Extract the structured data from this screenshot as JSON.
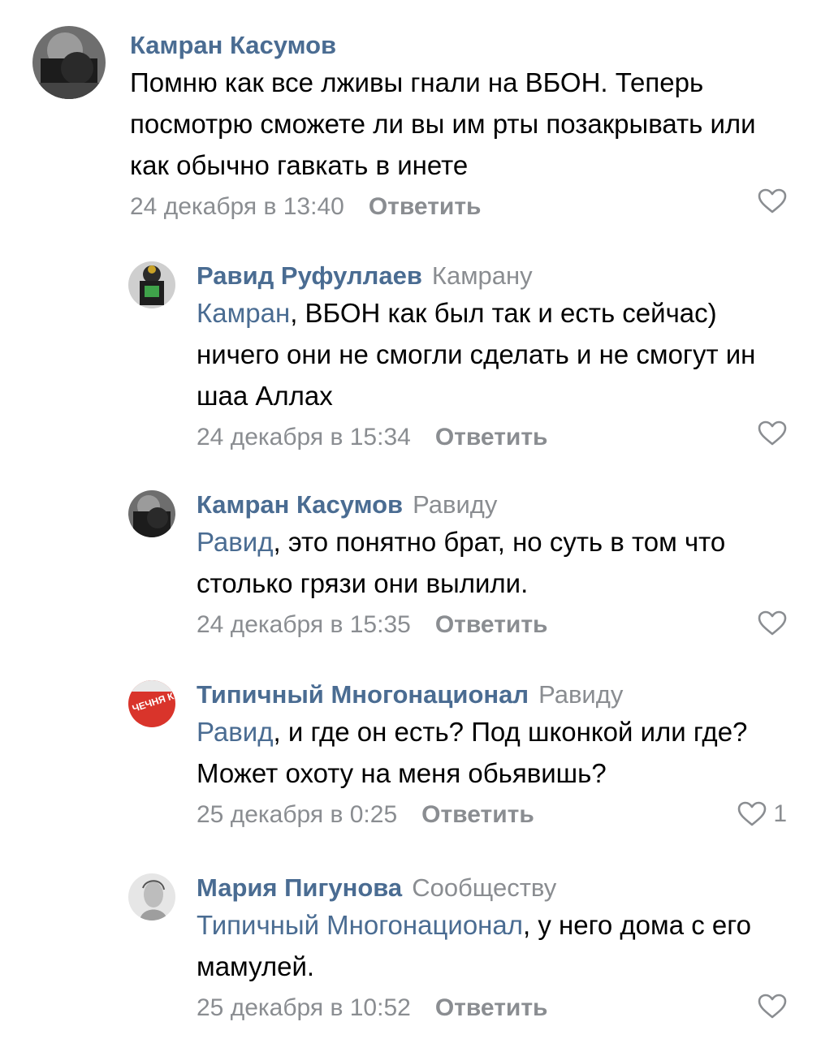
{
  "comments": [
    {
      "author": "Камран Касумов",
      "reply_to": "",
      "mention": "",
      "text": "Помню как все лживы гнали на ВБОН. Теперь посмотрю сможете ли вы им рты позакрывать или как обычно гавкать в инете",
      "date": "24 декабря в 13:40",
      "reply_label": "Ответить",
      "likes": "",
      "avatar_icon": "user-photo-dark"
    },
    {
      "author": "Равид Руфуллаев",
      "reply_to": "Камрану",
      "mention": "Камран",
      "text": ", ВБОН как был так и есть сейчас) ничего они не смогли сделать и не смогут ин шаа Аллах",
      "date": "24 декабря в 15:34",
      "reply_label": "Ответить",
      "likes": "",
      "avatar_icon": "user-photo-costume"
    },
    {
      "author": "Камран Касумов",
      "reply_to": "Равиду",
      "mention": "Равид",
      "text": ", это понятно брат, но суть в том что столько грязи они вылили.",
      "date": "24 декабря в 15:35",
      "reply_label": "Ответить",
      "likes": "",
      "avatar_icon": "user-photo-dark"
    },
    {
      "author": "Типичный Многонационал",
      "reply_to": "Равиду",
      "mention": "Равид",
      "text": ", и где он есть? Под шконкой или где? Может охоту на меня обьявишь?",
      "date": "25 декабря в 0:25",
      "reply_label": "Ответить",
      "likes": "1",
      "avatar_icon": "community-logo-red"
    },
    {
      "author": "Мария Пигунова",
      "reply_to": "Сообществу",
      "mention": "Типичный Многонационал",
      "text": ", у него дома с его мамулей.",
      "date": "25 декабря в 10:52",
      "reply_label": "Ответить",
      "likes": "",
      "avatar_icon": "user-photo-sketch"
    }
  ],
  "colors": {
    "author_link": "#4a6c92",
    "secondary_text": "#8a8d91",
    "background": "#ffffff"
  },
  "icons": {
    "like": "heart-outline-icon"
  },
  "avatar_texts": {
    "community_logo": "ЧЕЧНЯ КРУТО"
  }
}
